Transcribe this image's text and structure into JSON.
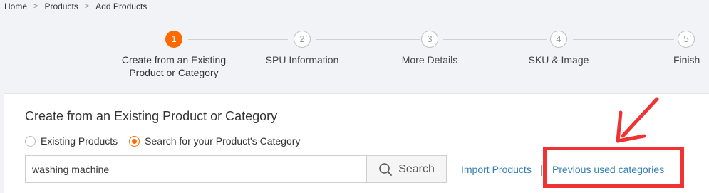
{
  "breadcrumb": {
    "items": [
      "Home",
      "Products",
      "Add Products"
    ],
    "separator": ">"
  },
  "stepper": {
    "steps": [
      {
        "number": "1",
        "label_line1": "Create from an Existing",
        "label_line2": "Product or Category",
        "active": true
      },
      {
        "number": "2",
        "label_line1": "SPU Information",
        "label_line2": "",
        "active": false
      },
      {
        "number": "3",
        "label_line1": "More Details",
        "label_line2": "",
        "active": false
      },
      {
        "number": "4",
        "label_line1": "SKU & Image",
        "label_line2": "",
        "active": false
      },
      {
        "number": "5",
        "label_line1": "Finish",
        "label_line2": "",
        "active": false
      }
    ],
    "colors": {
      "active": "#ff6a00",
      "inactive": "#bfbfbf"
    }
  },
  "card": {
    "title": "Create from an Existing Product or Category",
    "radio_options": [
      {
        "label": "Existing Products",
        "checked": false
      },
      {
        "label": "Search for your Product's Category",
        "checked": true
      }
    ],
    "search": {
      "value": "washing machine",
      "placeholder": "",
      "button_label": "Search",
      "button_icon": "search-icon"
    },
    "links": {
      "import": "Import Products",
      "previous": "Previous used categories"
    }
  },
  "annotation": {
    "color": "#f03232",
    "type": "red-box-with-arrow"
  }
}
